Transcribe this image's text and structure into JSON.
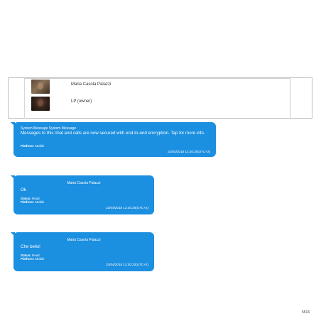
{
  "participants": [
    {
      "name": "Maria Casola Palazzi",
      "avatar": "participant-photo"
    },
    {
      "name": "LP (owner)",
      "avatar": "participant-photo"
    }
  ],
  "messages": [
    {
      "sender": "System Message System Message",
      "text": "Messages to this chat and calls are now secured with end-to-end encryption. Tap for more info.",
      "status_label": "",
      "status_value": "",
      "platform_label": "Platform:",
      "platform_value": "Mobile",
      "timestamp": "22/04/2018 12:30:25(UTC+2)"
    },
    {
      "sender": "Maria Casola Palazzi",
      "text": "Ok",
      "status_label": "Status:",
      "status_value": "Read",
      "platform_label": "Platform:",
      "platform_value": "Mobile",
      "timestamp": "22/04/2018 12:30:25(UTC+2)"
    },
    {
      "sender": "Maria Casola Palazzi",
      "text": "Che bello!",
      "status_label": "Status:",
      "status_value": "Read",
      "platform_label": "Platform:",
      "platform_value": "Mobile",
      "timestamp": "22/04/2018 12:30:32(UTC+2)"
    }
  ],
  "page_number": "5516",
  "colors": {
    "bubble": "#1b8fe0",
    "bubble_text": "#ffffff",
    "panel_border": "#bdbdbd"
  }
}
